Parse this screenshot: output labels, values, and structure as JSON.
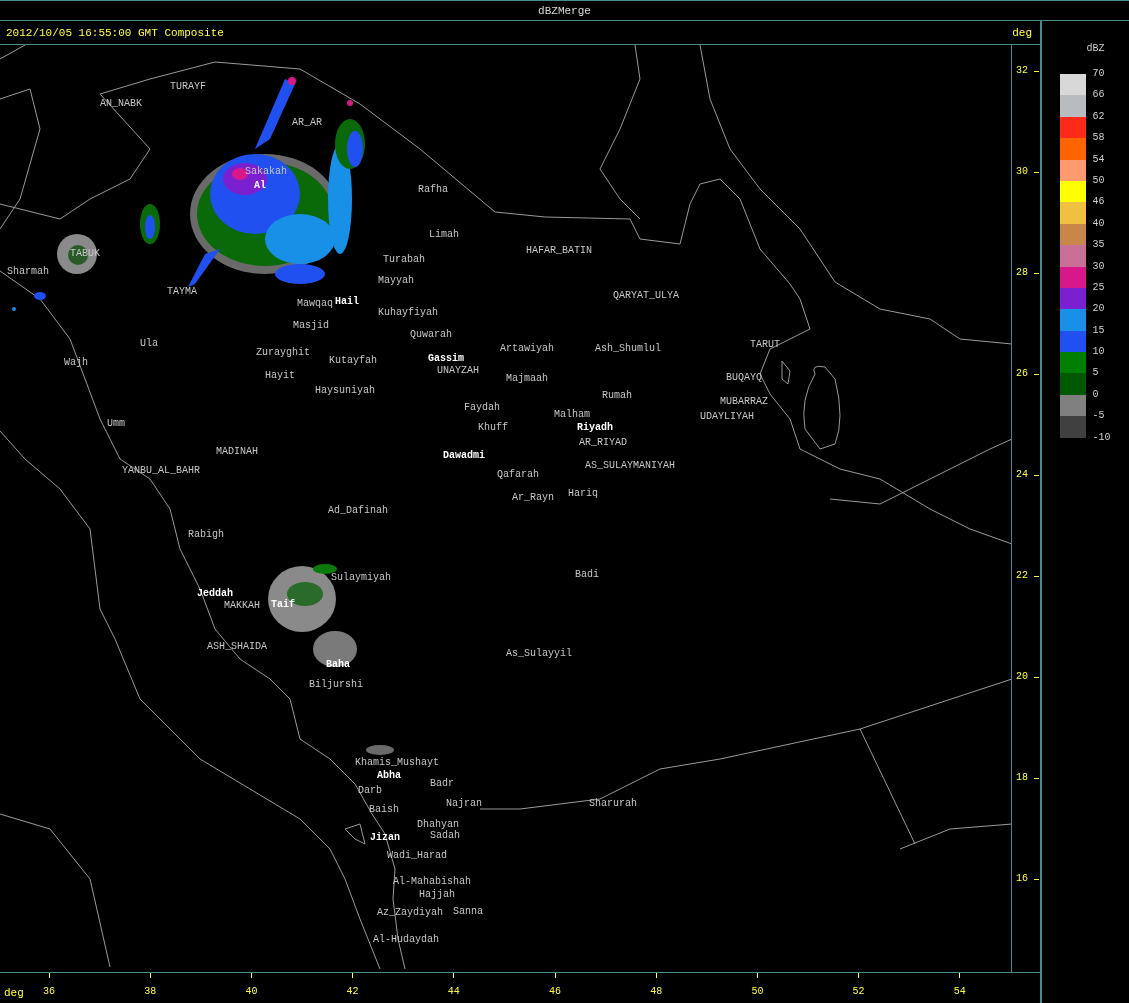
{
  "window": {
    "title": "dBZMerge"
  },
  "header": {
    "caption": "2012/10/05 16:55:00 GMT Composite",
    "axis_unit": "deg"
  },
  "map": {
    "places": [
      {
        "name": "AN_NABK",
        "kind": "place"
      },
      {
        "name": "TURAYF",
        "kind": "place"
      },
      {
        "name": "AR_AR",
        "kind": "place"
      },
      {
        "name": "Sakakah",
        "kind": "place"
      },
      {
        "name": "Al",
        "kind": "site"
      },
      {
        "name": "Rafha",
        "kind": "place"
      },
      {
        "name": "Limah",
        "kind": "place"
      },
      {
        "name": "HAFAR_BATIN",
        "kind": "place"
      },
      {
        "name": "TABUK",
        "kind": "place"
      },
      {
        "name": "Turabah",
        "kind": "place"
      },
      {
        "name": "Sharmah",
        "kind": "place"
      },
      {
        "name": "Mayyah",
        "kind": "place"
      },
      {
        "name": "TAYMA",
        "kind": "place"
      },
      {
        "name": "QARYAT_ULYA",
        "kind": "place"
      },
      {
        "name": "Mawqaq",
        "kind": "place"
      },
      {
        "name": "Hail",
        "kind": "site"
      },
      {
        "name": "Kuhayfiyah",
        "kind": "place"
      },
      {
        "name": "Masjid",
        "kind": "place"
      },
      {
        "name": "Quwarah",
        "kind": "place"
      },
      {
        "name": "Ula",
        "kind": "place"
      },
      {
        "name": "Artawiyah",
        "kind": "place"
      },
      {
        "name": "Ash_Shumlul",
        "kind": "place"
      },
      {
        "name": "TARUT",
        "kind": "place"
      },
      {
        "name": "Zurayghit",
        "kind": "place"
      },
      {
        "name": "Kutayfah",
        "kind": "place"
      },
      {
        "name": "Gassim",
        "kind": "site"
      },
      {
        "name": "Wajh",
        "kind": "place"
      },
      {
        "name": "UNAYZAH",
        "kind": "place"
      },
      {
        "name": "Hayit",
        "kind": "place"
      },
      {
        "name": "Majmaah",
        "kind": "place"
      },
      {
        "name": "BUQAYQ",
        "kind": "place"
      },
      {
        "name": "Haysuniyah",
        "kind": "place"
      },
      {
        "name": "Rumah",
        "kind": "place"
      },
      {
        "name": "MUBARRAZ",
        "kind": "place"
      },
      {
        "name": "Faydah",
        "kind": "place"
      },
      {
        "name": "Malham",
        "kind": "place"
      },
      {
        "name": "UDAYLIYAH",
        "kind": "place"
      },
      {
        "name": "Umm",
        "kind": "place"
      },
      {
        "name": "Khuff",
        "kind": "place"
      },
      {
        "name": "Riyadh",
        "kind": "site"
      },
      {
        "name": "AR_RIYAD",
        "kind": "place"
      },
      {
        "name": "MADINAH",
        "kind": "place"
      },
      {
        "name": "Dawadmi",
        "kind": "site"
      },
      {
        "name": "AS_SULAYMANIYAH",
        "kind": "place"
      },
      {
        "name": "YANBU_AL_BAHR",
        "kind": "place"
      },
      {
        "name": "Qafarah",
        "kind": "place"
      },
      {
        "name": "Hariq",
        "kind": "place"
      },
      {
        "name": "Ar_Rayn",
        "kind": "place"
      },
      {
        "name": "Ad_Dafinah",
        "kind": "place"
      },
      {
        "name": "Rabigh",
        "kind": "place"
      },
      {
        "name": "Sulaymiyah",
        "kind": "place"
      },
      {
        "name": "Badi",
        "kind": "place"
      },
      {
        "name": "Jeddah",
        "kind": "site"
      },
      {
        "name": "MAKKAH",
        "kind": "place"
      },
      {
        "name": "Taif",
        "kind": "site"
      },
      {
        "name": "ASH_SHAIDA",
        "kind": "place"
      },
      {
        "name": "As_Sulayyil",
        "kind": "place"
      },
      {
        "name": "Baha",
        "kind": "site"
      },
      {
        "name": "Biljurshi",
        "kind": "place"
      },
      {
        "name": "Khamis_Mushayt",
        "kind": "place"
      },
      {
        "name": "Abha",
        "kind": "site"
      },
      {
        "name": "Badr",
        "kind": "place"
      },
      {
        "name": "Darb",
        "kind": "place"
      },
      {
        "name": "Najran",
        "kind": "place"
      },
      {
        "name": "Sharurah",
        "kind": "place"
      },
      {
        "name": "Baish",
        "kind": "place"
      },
      {
        "name": "Dhahyan",
        "kind": "place"
      },
      {
        "name": "Sadah",
        "kind": "place"
      },
      {
        "name": "Jizan",
        "kind": "site"
      },
      {
        "name": "Wadi_Harad",
        "kind": "place"
      },
      {
        "name": "Al-Mahabishah",
        "kind": "place"
      },
      {
        "name": "Hajjah",
        "kind": "place"
      },
      {
        "name": "Az_Zaydiyah",
        "kind": "place"
      },
      {
        "name": "Sanna",
        "kind": "place"
      },
      {
        "name": "Al-Hudaydah",
        "kind": "place"
      }
    ]
  },
  "lat_axis": {
    "ticks": [
      "32",
      "30",
      "28",
      "26",
      "24",
      "22",
      "20",
      "18",
      "16"
    ]
  },
  "lon_axis": {
    "unit": "deg",
    "ticks": [
      "36",
      "38",
      "40",
      "42",
      "44",
      "46",
      "48",
      "50",
      "52",
      "54"
    ]
  },
  "legend": {
    "title": "dBZ",
    "bands": [
      {
        "color": "#d8d8d8"
      },
      {
        "color": "#b8bcc0"
      },
      {
        "color": "#ff2a1a"
      },
      {
        "color": "#ff6400"
      },
      {
        "color": "#ff9a70"
      },
      {
        "color": "#ffff00"
      },
      {
        "color": "#f0c040"
      },
      {
        "color": "#c8864a"
      },
      {
        "color": "#c87098"
      },
      {
        "color": "#d8188a"
      },
      {
        "color": "#7a20d0"
      },
      {
        "color": "#1890e8"
      },
      {
        "color": "#2050f0"
      },
      {
        "color": "#008000"
      },
      {
        "color": "#005800"
      },
      {
        "color": "#808080"
      },
      {
        "color": "#404040"
      }
    ],
    "labels": [
      "70",
      "66",
      "62",
      "58",
      "54",
      "50",
      "46",
      "40",
      "35",
      "30",
      "25",
      "20",
      "15",
      "10",
      "5",
      "0",
      "-5",
      "-10"
    ]
  }
}
